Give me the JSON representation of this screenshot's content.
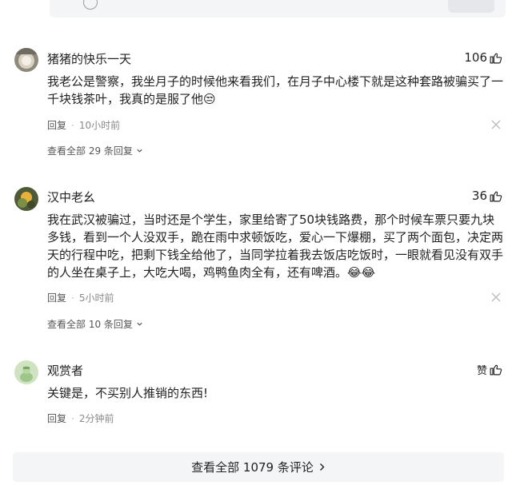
{
  "comments": [
    {
      "username": "猪猪的快乐一天",
      "likes": "106",
      "text": "我老公是警察，我坐月子的时候他来看我们，在月子中心楼下就是这种套路被骗买了一千块钱茶叶，我真的是服了他😒",
      "reply_label": "回复",
      "time": "10小时前",
      "view_replies": "查看全部 29 条回复"
    },
    {
      "username": "汉中老幺",
      "likes": "36",
      "text": "我在武汉被骗过，当时还是个学生，家里给寄了50块钱路费，那个时候车票只要九块多钱，看到一个人没双手，跪在雨中求顿饭吃，爱心一下爆棚，买了两个面包，决定两天的行程中吃，把剩下钱全给他了，当同学拉着我去饭店吃饭时，一眼就看见没有双手的人坐在桌子上，大吃大喝，鸡鸭鱼肉全有，还有啤酒。😂😂",
      "reply_label": "回复",
      "time": "5小时前",
      "view_replies": "查看全部 10 条回复"
    },
    {
      "username": "观赏者",
      "likes": "赞",
      "text": "关键是，不买别人推销的东西!",
      "reply_label": "回复",
      "time": "2分钟前"
    }
  ],
  "footer": {
    "all_comments": "查看全部 1079 条评论"
  },
  "icons": {
    "like": "thumbs-up-icon",
    "close": "close-icon",
    "chevron_down": "chevron-down-icon",
    "chevron_right": "chevron-right-icon"
  }
}
